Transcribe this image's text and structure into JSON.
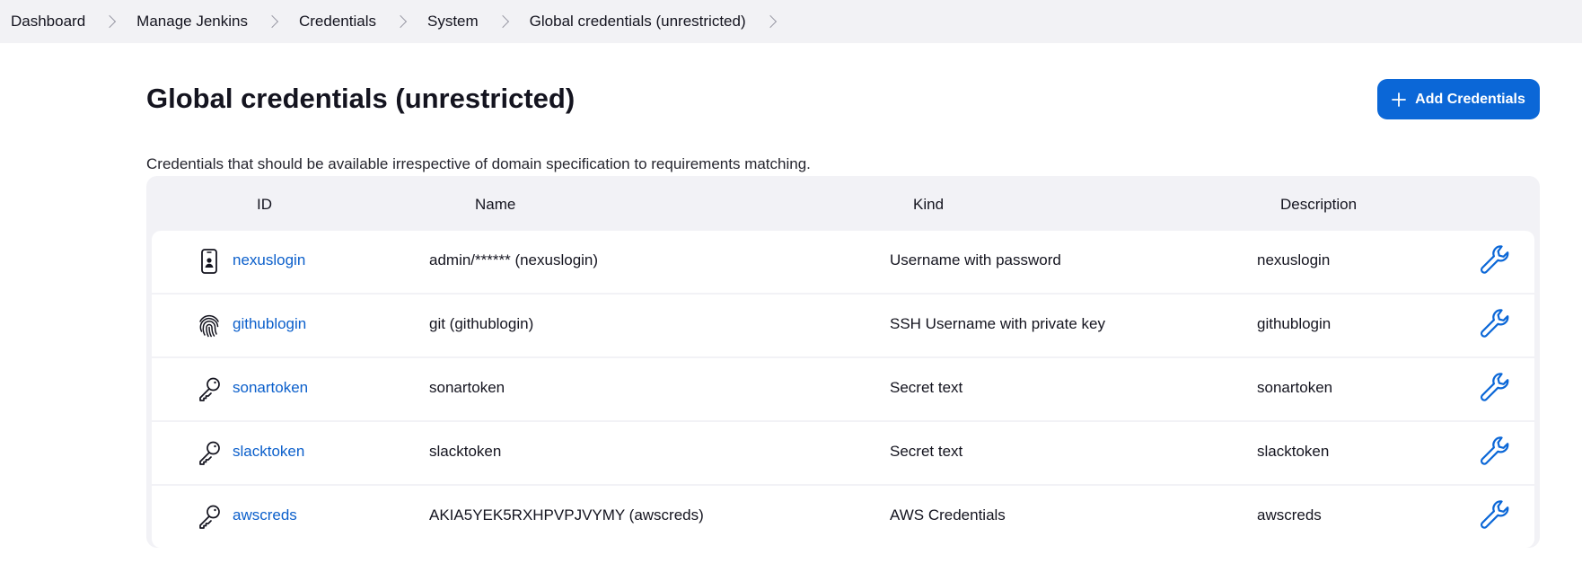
{
  "breadcrumb": [
    {
      "label": "Dashboard"
    },
    {
      "label": "Manage Jenkins"
    },
    {
      "label": "Credentials"
    },
    {
      "label": "System"
    },
    {
      "label": "Global credentials (unrestricted)"
    }
  ],
  "page": {
    "title": "Global credentials (unrestricted)",
    "add_button_label": "Add Credentials",
    "description": "Credentials that should be available irrespective of domain specification to requirements matching."
  },
  "table": {
    "headers": {
      "id": "ID",
      "name": "Name",
      "kind": "Kind",
      "description": "Description"
    },
    "rows": [
      {
        "icon": "mobile-person-icon",
        "id": "nexuslogin",
        "name": "admin/****** (nexuslogin)",
        "kind": "Username with password",
        "description": "nexuslogin"
      },
      {
        "icon": "fingerprint-icon",
        "id": "githublogin",
        "name": "git (githublogin)",
        "kind": "SSH Username with private key",
        "description": "githublogin"
      },
      {
        "icon": "key-icon",
        "id": "sonartoken",
        "name": "sonartoken",
        "kind": "Secret text",
        "description": "sonartoken"
      },
      {
        "icon": "key-icon",
        "id": "slacktoken",
        "name": "slacktoken",
        "kind": "Secret text",
        "description": "slacktoken"
      },
      {
        "icon": "key-icon",
        "id": "awscreds",
        "name": "AKIA5YEK5RXHPVPJVYMY (awscreds)",
        "kind": "AWS Credentials",
        "description": "awscreds"
      }
    ]
  },
  "colors": {
    "accent": "#0b67d7",
    "link": "#0b5fcb",
    "panel": "#f2f2f6"
  }
}
